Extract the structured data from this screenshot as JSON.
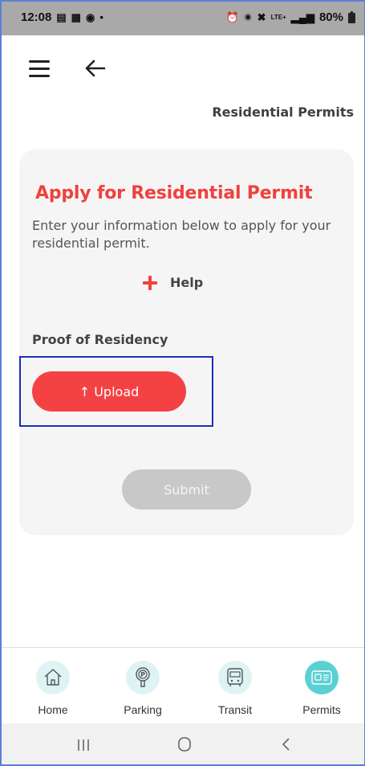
{
  "status_bar": {
    "time": "12:08",
    "battery": "80%",
    "signal_label": "LTE+"
  },
  "header": {
    "title": "Residential Permits"
  },
  "card": {
    "title": "Apply for Residential Permit",
    "description": "Enter your information below to apply for your residential permit.",
    "help_label": "Help",
    "section_label": "Proof of Residency",
    "upload_label": "↑ Upload",
    "submit_label": "Submit"
  },
  "bottom_nav": {
    "items": [
      {
        "label": "Home",
        "icon": "home-icon"
      },
      {
        "label": "Parking",
        "icon": "parking-meter-icon"
      },
      {
        "label": "Transit",
        "icon": "bus-icon"
      },
      {
        "label": "Permits",
        "icon": "id-card-icon",
        "active": true
      }
    ]
  },
  "colors": {
    "accent": "#f0413d",
    "nav_active": "#5bd0d3",
    "nav_inactive": "#dff3f4",
    "disabled": "#c8c8c8"
  }
}
